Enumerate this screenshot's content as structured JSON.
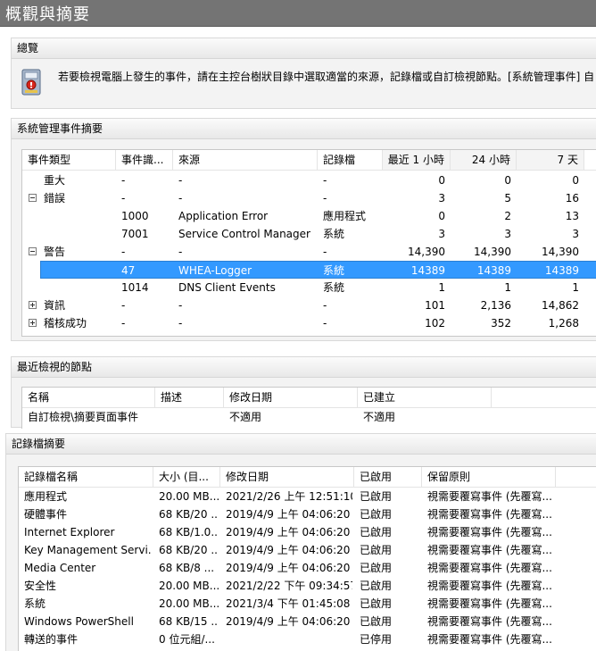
{
  "window": {
    "title": "概觀與摘要"
  },
  "overview": {
    "header": "總覽",
    "icon": "event-viewer-icon",
    "text": "若要檢視電腦上發生的事件，請在主控台樹狀目錄中選取適當的來源，記錄檔或自訂檢視節點。[系統管理事件] 自"
  },
  "admin_summary": {
    "header": "系統管理事件摘要",
    "columns": [
      "事件類型",
      "事件識...",
      "來源",
      "記錄檔",
      "最近 1 小時",
      "24 小時",
      "7 天"
    ],
    "rows": [
      {
        "type": "重大",
        "id": "-",
        "source": "-",
        "log": "-",
        "h1": "0",
        "h24": "0",
        "d7": "0"
      },
      {
        "type": "錯誤",
        "id": "-",
        "source": "-",
        "log": "-",
        "h1": "3",
        "h24": "5",
        "d7": "16"
      },
      {
        "type": "",
        "id": "1000",
        "source": "Application Error",
        "log": "應用程式",
        "h1": "0",
        "h24": "2",
        "d7": "13"
      },
      {
        "type": "",
        "id": "7001",
        "source": "Service Control Manager",
        "log": "系統",
        "h1": "3",
        "h24": "3",
        "d7": "3"
      },
      {
        "type": "警告",
        "id": "-",
        "source": "-",
        "log": "-",
        "h1": "14,390",
        "h24": "14,390",
        "d7": "14,390"
      },
      {
        "type": "",
        "id": "47",
        "source": "WHEA-Logger",
        "log": "系統",
        "h1": "14389",
        "h24": "14389",
        "d7": "14389"
      },
      {
        "type": "",
        "id": "1014",
        "source": "DNS Client Events",
        "log": "系統",
        "h1": "1",
        "h24": "1",
        "d7": "1"
      },
      {
        "type": "資訊",
        "id": "-",
        "source": "-",
        "log": "-",
        "h1": "101",
        "h24": "2,136",
        "d7": "14,862"
      },
      {
        "type": "稽核成功",
        "id": "-",
        "source": "-",
        "log": "-",
        "h1": "102",
        "h24": "352",
        "d7": "1,268"
      }
    ]
  },
  "recent_nodes": {
    "header": "最近檢視的節點",
    "columns": [
      "名稱",
      "描述",
      "修改日期",
      "已建立"
    ],
    "rows": [
      {
        "name": "自訂檢視\\摘要頁面事件",
        "desc": "",
        "modified": "不適用",
        "created": "不適用"
      }
    ]
  },
  "log_summary": {
    "header": "記錄檔摘要",
    "columns": [
      "記錄檔名稱",
      "大小 (目...",
      "修改日期",
      "已啟用",
      "保留原則"
    ],
    "rows": [
      {
        "name": "應用程式",
        "size": "20.00 MB...",
        "modified": "2021/2/26 上午 12:51:10",
        "enabled": "已啟用",
        "policy": "視需要覆寫事件 (先覆寫..."
      },
      {
        "name": "硬體事件",
        "size": "68 KB/20 ...",
        "modified": "2019/4/9 上午 04:06:20",
        "enabled": "已啟用",
        "policy": "視需要覆寫事件 (先覆寫..."
      },
      {
        "name": "Internet Explorer",
        "size": "68 KB/1.0...",
        "modified": "2019/4/9 上午 04:06:20",
        "enabled": "已啟用",
        "policy": "視需要覆寫事件 (先覆寫..."
      },
      {
        "name": "Key Management Servi...",
        "size": "68 KB/20 ...",
        "modified": "2019/4/9 上午 04:06:20",
        "enabled": "已啟用",
        "policy": "視需要覆寫事件 (先覆寫..."
      },
      {
        "name": "Media Center",
        "size": "68 KB/8 ...",
        "modified": "2019/4/9 上午 04:06:20",
        "enabled": "已啟用",
        "policy": "視需要覆寫事件 (先覆寫..."
      },
      {
        "name": "安全性",
        "size": "20.00 MB...",
        "modified": "2021/2/22 下午 09:34:57",
        "enabled": "已啟用",
        "policy": "視需要覆寫事件 (先覆寫..."
      },
      {
        "name": "系統",
        "size": "20.00 MB...",
        "modified": "2021/3/4 下午 01:45:08",
        "enabled": "已啟用",
        "policy": "視需要覆寫事件 (先覆寫..."
      },
      {
        "name": "Windows PowerShell",
        "size": "68 KB/15 ...",
        "modified": "2019/4/9 上午 04:06:20",
        "enabled": "已啟用",
        "policy": "視需要覆寫事件 (先覆寫..."
      },
      {
        "name": "轉送的事件",
        "size": "0 位元組/...",
        "modified": "",
        "enabled": "已停用",
        "policy": "視需要覆寫事件 (先覆寫..."
      }
    ]
  },
  "colors": {
    "selection": "#3399ff",
    "titlebar": "#747474"
  }
}
